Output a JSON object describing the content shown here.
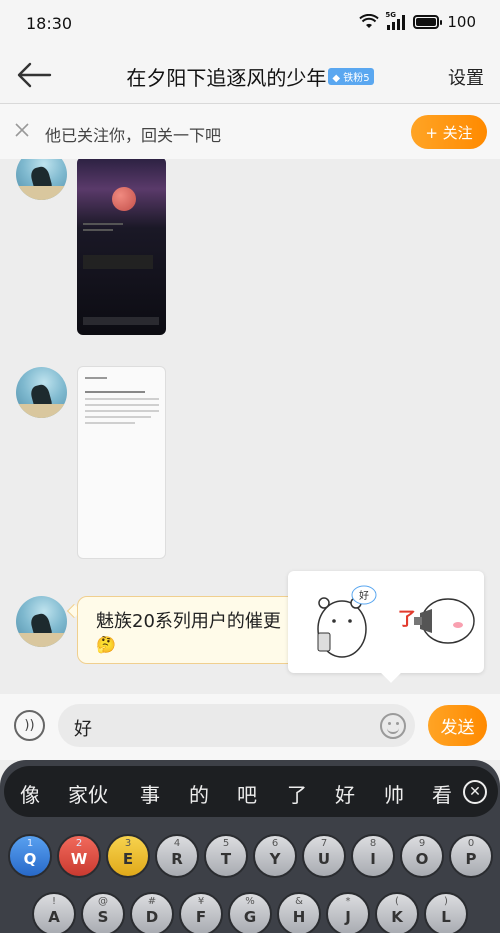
{
  "status_bar": {
    "time": "18:30",
    "network": "5G",
    "battery": "100"
  },
  "header": {
    "title": "在夕阳下追逐风的少年",
    "badge": "铁粉5",
    "settings_label": "设置"
  },
  "follow_banner": {
    "message": "他已关注你，回关一下吧",
    "follow_label": "+ 关注"
  },
  "messages": {
    "text_bubble": "魅族20系列用户的催更",
    "text_bubble_emoji": "🤔"
  },
  "sticker_suggestion": {
    "sticker1_text": "好",
    "sticker2_text": "了"
  },
  "input": {
    "value": "好",
    "send_label": "发送"
  },
  "keyboard": {
    "candidates": [
      "像",
      "家伙",
      "事",
      "的",
      "吧",
      "了",
      "好",
      "帅",
      "看"
    ],
    "row1": [
      {
        "pri": "Q",
        "sec": "1"
      },
      {
        "pri": "W",
        "sec": "2"
      },
      {
        "pri": "E",
        "sec": "3"
      },
      {
        "pri": "R",
        "sec": "4"
      },
      {
        "pri": "T",
        "sec": "5"
      },
      {
        "pri": "Y",
        "sec": "6"
      },
      {
        "pri": "U",
        "sec": "7"
      },
      {
        "pri": "I",
        "sec": "8"
      },
      {
        "pri": "O",
        "sec": "9"
      },
      {
        "pri": "P",
        "sec": "0"
      }
    ],
    "row2": [
      {
        "pri": "A",
        "sec": "!"
      },
      {
        "pri": "S",
        "sec": "@"
      },
      {
        "pri": "D",
        "sec": "#"
      },
      {
        "pri": "F",
        "sec": "¥"
      },
      {
        "pri": "G",
        "sec": "%"
      },
      {
        "pri": "H",
        "sec": "&"
      },
      {
        "pri": "J",
        "sec": "*"
      },
      {
        "pri": "K",
        "sec": "("
      },
      {
        "pri": "L",
        "sec": ")"
      }
    ]
  },
  "colors": {
    "accent": "#ff9a1a",
    "bubble_bg": "#fffbe9",
    "badge": "#5aa7f0"
  }
}
